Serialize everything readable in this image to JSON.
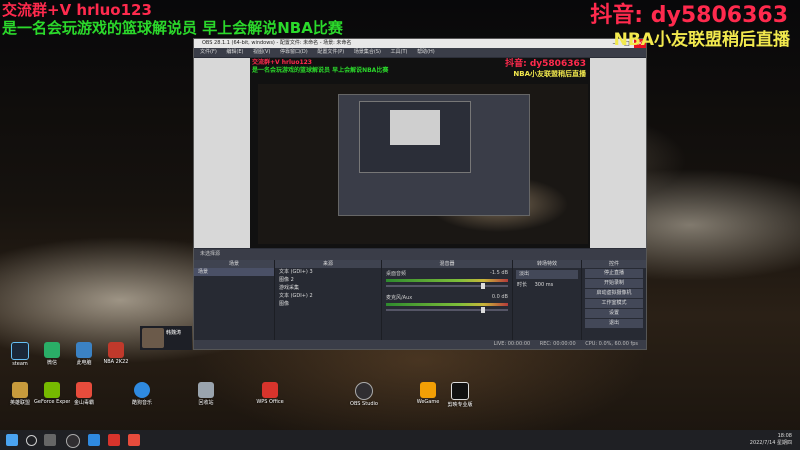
{
  "overlays": {
    "top_left_line1": "交流群+V hrluo123",
    "top_left_line2": "是一名会玩游戏的篮球解说员 早上会解说NBA比赛",
    "top_right_line1": "抖音: dy5806363",
    "top_right_line2": "NBA小友联盟稍后直播"
  },
  "obs": {
    "title": "OBS 28.1.1 (64-bit, windows) - 配置文件: 未命名 - 场景: 未命名",
    "menu": [
      "文件(F)",
      "编辑(E)",
      "视图(V)",
      "停靠窗口(D)",
      "配置文件(P)",
      "场景集合(S)",
      "工具(T)",
      "帮助(H)"
    ],
    "preview_overlay_l1": "交流群+V hrluo123",
    "preview_overlay_l2": "是一名会玩游戏的篮球解说员 早上会解说NBA比赛",
    "preview_overlay_r1": "抖音: dy5806363",
    "preview_overlay_r2": "NBA小友联盟稍后直播",
    "source_bar": "未选择源",
    "docks": {
      "scenes_header": "场景",
      "scenes": [
        "场景"
      ],
      "sources_header": "来源",
      "sources": [
        "文本 (GDI+) 3",
        "图像 2",
        "游戏采集",
        "文本 (GDI+) 2",
        "图像"
      ],
      "mixer_header": "混音器",
      "mixer_channels": [
        {
          "name": "桌面音频",
          "db": "-1.5 dB"
        },
        {
          "name": "麦克风/Aux",
          "db": "0.0 dB"
        }
      ],
      "transitions_header": "转场特效",
      "transition": "淡出",
      "duration_label": "时长",
      "duration": "300 ms",
      "controls_header": "控件",
      "controls": [
        "停止直播",
        "开始录制",
        "启动虚拟摄像机",
        "工作室模式",
        "设置",
        "退出"
      ]
    },
    "status": [
      "LIVE: 00:00:00",
      "REC: 00:00:00",
      "CPU: 0.0%, 60.00 fps"
    ]
  },
  "streamer": {
    "name": "韩魏涛"
  },
  "desktop_icons": [
    {
      "label": "steam",
      "color": "#1b2838"
    },
    {
      "label": "微信",
      "color": "#2aae67"
    },
    {
      "label": "此电脑",
      "color": "#3b82c4"
    },
    {
      "label": "NBA 2K22",
      "color": "#c0392b"
    },
    {
      "label": "英雄联盟",
      "color": "#c89b3c"
    },
    {
      "label": "GeForce Experience",
      "color": "#76b900"
    },
    {
      "label": "金山毒霸",
      "color": "#e74c3c"
    },
    {
      "label": "酷狗音乐",
      "color": "#2f8ae0"
    },
    {
      "label": "回收站",
      "color": "#9aa4ae"
    },
    {
      "label": "WPS Office",
      "color": "#d8342c"
    },
    {
      "label": "OBS Studio",
      "color": "#302e31"
    },
    {
      "label": "WeGame",
      "color": "#f29f05"
    },
    {
      "label": "剪映专业版",
      "color": "#111111"
    }
  ],
  "taskbar": {
    "time": "18:08",
    "date": "2022/7/14 星期四"
  }
}
